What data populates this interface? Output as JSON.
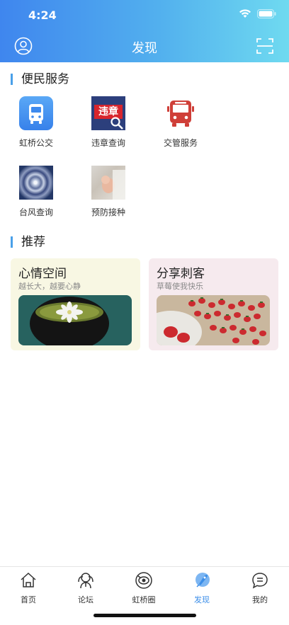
{
  "status_bar": {
    "time": "4:24"
  },
  "header": {
    "title": "发现"
  },
  "sections": {
    "services_title": "便民服务",
    "recommend_title": "推荐"
  },
  "services": [
    {
      "label": "虹桥公交",
      "icon": "bus-icon"
    },
    {
      "label": "违章查询",
      "icon": "violation-query-icon",
      "icon_text": "违章"
    },
    {
      "label": "交管服务",
      "icon": "traffic-bus-icon"
    },
    {
      "label": "台风查询",
      "icon": "typhoon-image"
    },
    {
      "label": "预防接种",
      "icon": "vaccination-image"
    }
  ],
  "cards": [
    {
      "title": "心情空间",
      "subtitle": "越长大，越要心静"
    },
    {
      "title": "分享刺客",
      "subtitle": "草莓使我快乐"
    }
  ],
  "tabbar": {
    "items": [
      {
        "label": "首页",
        "icon": "home-icon"
      },
      {
        "label": "论坛",
        "icon": "forum-icon"
      },
      {
        "label": "虹桥圈",
        "icon": "circle-icon"
      },
      {
        "label": "发现",
        "icon": "discover-rocket-icon"
      },
      {
        "label": "我的",
        "icon": "my-chat-icon"
      }
    ],
    "active": "发现"
  },
  "colors": {
    "accent": "#3c8ee8",
    "header_start": "#3f86ee",
    "header_end": "#6fdaf0"
  }
}
